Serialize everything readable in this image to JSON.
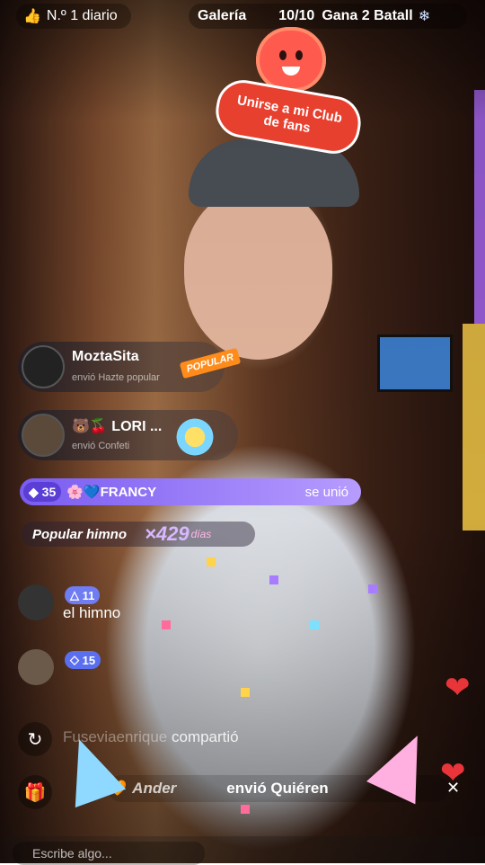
{
  "topbar": {
    "rank_label": "N.º 1 diario",
    "gallery_label": "Galería",
    "gallery_progress": "10/10",
    "battle_label": "Gana 2 Batall"
  },
  "fan_club": {
    "line1": "Unirse a mi Club",
    "line2": "de fans"
  },
  "gifts": [
    {
      "user": "MoztaSita",
      "subtitle": "envió Hazte popular",
      "gift_tag": "POPULAR"
    },
    {
      "user": "LORI ...",
      "subtitle": "envió Confeti"
    }
  ],
  "join": {
    "level": "35",
    "name": "FRANCY",
    "action": "se unió"
  },
  "hymn": {
    "label": "Popular himno",
    "count": "×429",
    "unit": "días"
  },
  "chat": [
    {
      "level": "11",
      "text": "el himno"
    },
    {
      "level": "15",
      "text": ""
    }
  ],
  "share": {
    "user": "Fuseviaenrique",
    "action": "compartió"
  },
  "sent": {
    "user": "Ander",
    "action": "envió Quiéren"
  },
  "icons": {
    "share": "repost-icon",
    "gift": "gift-icon",
    "close": "close-icon"
  },
  "comment_placeholder": "Escribe algo..."
}
